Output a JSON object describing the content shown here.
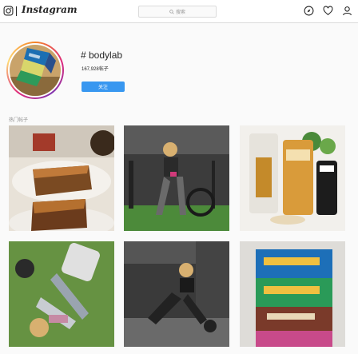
{
  "header": {
    "logo_text": "Instagram",
    "search_placeholder": "搜索",
    "icons": [
      "camera-icon",
      "compass-icon",
      "heart-icon",
      "user-icon"
    ]
  },
  "profile": {
    "hashtag": "# bodylab",
    "posts_count": "167,928帖子",
    "follow_label": "关注"
  },
  "section": {
    "title": "热门帖子"
  },
  "posts": [
    {
      "subject": "chocolate nut cake slices on plate"
    },
    {
      "subject": "woman on air bike in gym"
    },
    {
      "subject": "whey protein bag with fruit"
    },
    {
      "subject": "woman doing exercise on floor"
    },
    {
      "subject": "woman sitting with kettlebell in gym"
    },
    {
      "subject": "stacked bodylab product boxes"
    }
  ],
  "colors": {
    "accent": "#3897f0",
    "background": "#fafafa",
    "border": "#dbdbdb"
  }
}
